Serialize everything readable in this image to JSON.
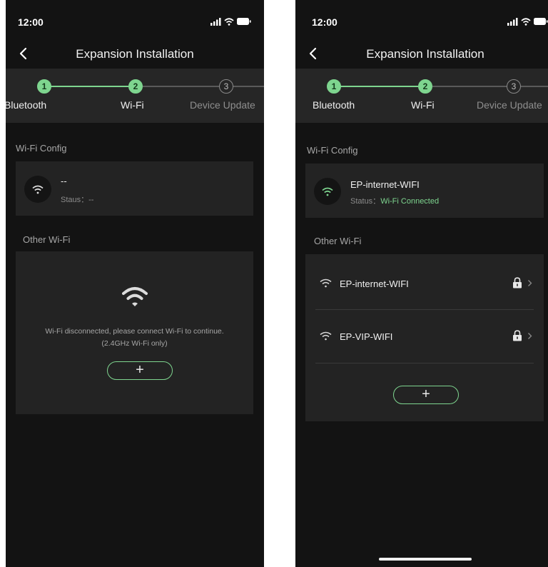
{
  "left_screen": {
    "status_time": "12:00",
    "title": "Expansion Installation",
    "steps": [
      {
        "number": "1",
        "label": "Bluetooth"
      },
      {
        "number": "2",
        "label": "Wi-Fi"
      },
      {
        "number": "3",
        "label": "Device Update"
      }
    ],
    "wifi_config_label": "Wi-Fi Config",
    "current_network": {
      "name": "--",
      "status_prefix": "Staus：",
      "status_value": "--"
    },
    "other_wifi_label": "Other Wi-Fi",
    "empty_message_line1": "Wi-Fi disconnected, please connect Wi-Fi to continue.",
    "empty_message_line2": "(2.4GHz Wi-Fi only)",
    "add_label": "+"
  },
  "right_screen": {
    "status_time": "12:00",
    "title": "Expansion Installation",
    "steps": [
      {
        "number": "1",
        "label": "Bluetooth"
      },
      {
        "number": "2",
        "label": "Wi-Fi"
      },
      {
        "number": "3",
        "label": "Device Update"
      }
    ],
    "wifi_config_label": "Wi-Fi Config",
    "current_network": {
      "name": "EP-internet-WIFI",
      "status_prefix": "Status：",
      "status_value": "Wi-Fi Connected"
    },
    "other_wifi_label": "Other Wi-Fi",
    "networks": [
      {
        "name": "EP-internet-WIFI",
        "secured": true
      },
      {
        "name": "EP-VIP-WIFI",
        "secured": true
      }
    ],
    "add_label": "+"
  },
  "colors": {
    "accent": "#7ed58f",
    "background": "#131313",
    "card": "#232323",
    "stepper_bg": "#262626"
  },
  "icons": [
    "signal-icon",
    "wifi-icon",
    "battery-icon",
    "back-arrow-icon",
    "lock-icon",
    "chevron-right-icon"
  ]
}
